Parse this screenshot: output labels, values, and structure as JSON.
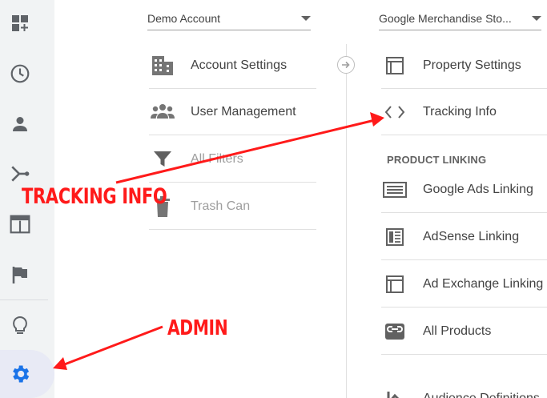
{
  "account_selector": {
    "value": "Demo Account"
  },
  "property_selector": {
    "value": "Google Merchandise Sto..."
  },
  "account_column": {
    "items": [
      {
        "label": "Account Settings",
        "icon": "building-icon"
      },
      {
        "label": "User Management",
        "icon": "users-icon"
      },
      {
        "label": "All Filters",
        "icon": "filter-icon"
      },
      {
        "label": "Trash Can",
        "icon": "trash-icon"
      }
    ]
  },
  "property_column": {
    "items": [
      {
        "label": "Property Settings",
        "icon": "layout-icon"
      },
      {
        "label": "Tracking Info",
        "icon": "code-icon"
      }
    ],
    "product_linking": {
      "heading": "PRODUCT LINKING",
      "items": [
        {
          "label": "Google Ads Linking",
          "icon": "ads-icon"
        },
        {
          "label": "AdSense Linking",
          "icon": "adsense-icon"
        },
        {
          "label": "Ad Exchange Linking",
          "icon": "ad-exchange-icon"
        },
        {
          "label": "All Products",
          "icon": "link-icon"
        }
      ]
    },
    "next_item_partial": "Audience Definitions"
  },
  "annotations": {
    "tracking_info": "TRACKING INFO",
    "admin": "ADMIN"
  },
  "colors": {
    "accent": "#1a73e8",
    "annotation": "#ff1a1a",
    "rail_bg": "#f1f3f4",
    "icon_gray": "#616161"
  }
}
